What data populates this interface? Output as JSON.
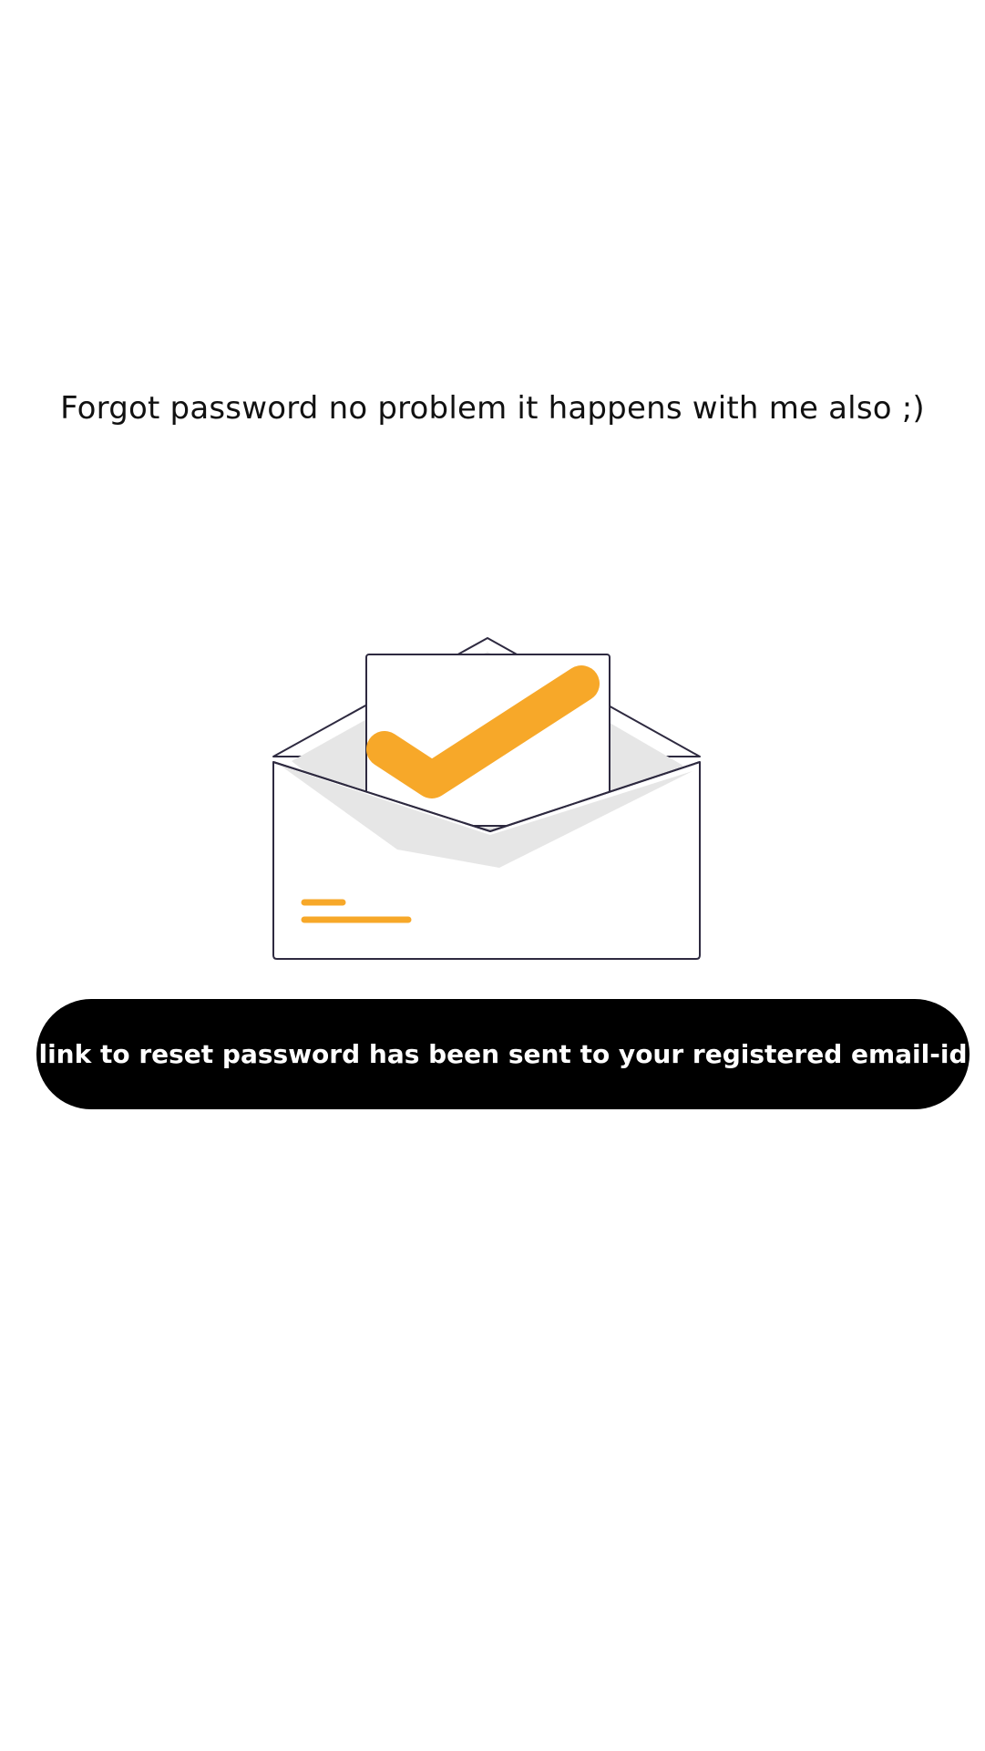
{
  "screen": {
    "heading": "Forgot password no problem it happens with me also ;)",
    "status_message": "link to reset password has been sent to your registered email-id"
  },
  "illustration": {
    "icon": "envelope-check-icon",
    "accent_color": "#F7A829",
    "outline_color": "#2E2A40",
    "shadow_color": "#E6E6E6"
  },
  "colors": {
    "background": "#FFFFFF",
    "heading_text": "#111111",
    "pill_background": "#000000",
    "pill_text": "#FFFFFF"
  }
}
